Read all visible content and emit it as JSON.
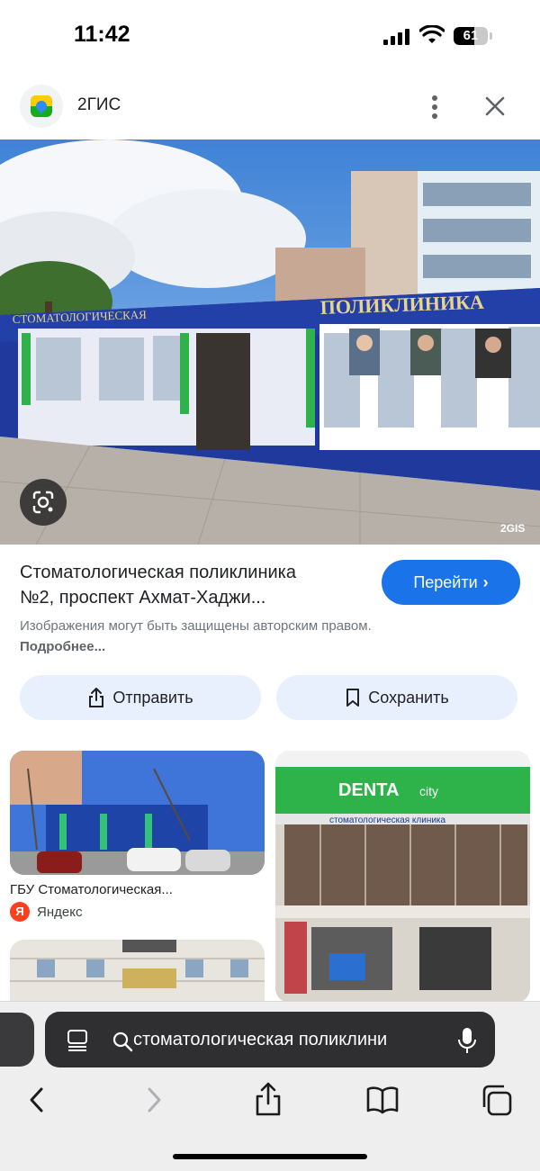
{
  "status_bar": {
    "time": "11:42",
    "battery": "61",
    "battery_level": 0.61
  },
  "header": {
    "app_name": "2ГИС",
    "logo_icon": "2gis-logo-icon"
  },
  "hero": {
    "sign_left": "СТОМАТОЛОГИЧЕСКАЯ",
    "sign_main": "ПОЛИКЛИНИКА",
    "watermark": "2GIS"
  },
  "result": {
    "title_line1": "Стоматологическая поликлиника",
    "title_line2": "№2, проспект Ахмат-Хаджи...",
    "go_label": "Перейти",
    "copyright_text": "Изображения могут быть защищены авторским правом.",
    "more_label": "Подробнее...",
    "send_label": "Отправить",
    "save_label": "Сохранить"
  },
  "related": {
    "card1_caption": "ГБУ Стоматологическая...",
    "card1_source": "Яндекс",
    "card1_source_letter": "Я",
    "card2_sign": "DENTA",
    "card2_sign_suffix": "city",
    "card2_subsign": "стоматологическая клиника"
  },
  "browser": {
    "url_text": "стоматологическая поликлини"
  },
  "colors": {
    "accent": "#1a73e8",
    "action_bg": "#e8f0fe",
    "yandex": "#fc3f1d"
  }
}
